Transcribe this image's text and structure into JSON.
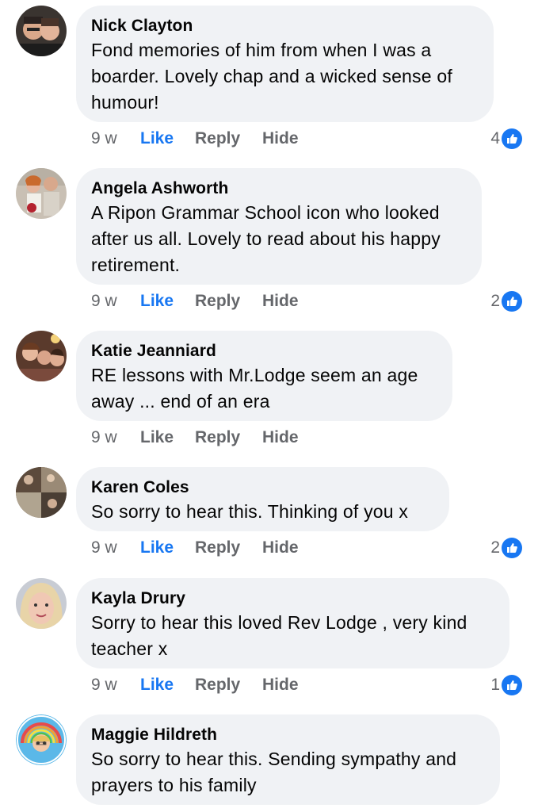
{
  "comments": [
    {
      "author": "Nick Clayton",
      "text": "Fond memories of him from when I was a boarder. Lovely chap and a wicked sense of humour!",
      "time": "9 w",
      "like_label": "Like",
      "reply_label": "Reply",
      "hide_label": "Hide",
      "liked": true,
      "reaction_count": "4"
    },
    {
      "author": "Angela Ashworth",
      "text": "A Ripon Grammar School icon who looked after us all. Lovely to read about his happy retirement.",
      "time": "9 w",
      "like_label": "Like",
      "reply_label": "Reply",
      "hide_label": "Hide",
      "liked": true,
      "reaction_count": "2"
    },
    {
      "author": "Katie Jeanniard",
      "text": "RE lessons with Mr.Lodge seem an age away ... end of an era",
      "time": "9 w",
      "like_label": "Like",
      "reply_label": "Reply",
      "hide_label": "Hide",
      "liked": false,
      "reaction_count": ""
    },
    {
      "author": "Karen Coles",
      "text": "So sorry to hear this. Thinking of you x",
      "time": "9 w",
      "like_label": "Like",
      "reply_label": "Reply",
      "hide_label": "Hide",
      "liked": true,
      "reaction_count": "2"
    },
    {
      "author": "Kayla Drury",
      "text": "Sorry to hear this loved Rev Lodge , very kind teacher x",
      "time": "9 w",
      "like_label": "Like",
      "reply_label": "Reply",
      "hide_label": "Hide",
      "liked": true,
      "reaction_count": "1"
    },
    {
      "author": "Maggie Hildreth",
      "text": "So sorry to hear this. Sending sympathy and prayers to his family",
      "time": "",
      "like_label": "",
      "reply_label": "",
      "hide_label": "",
      "liked": false,
      "reaction_count": ""
    }
  ],
  "colors": {
    "bubble": "#f0f2f5",
    "like_active": "#1877f2",
    "meta": "#65676b"
  },
  "icons": {
    "reaction": "thumbs-up-icon"
  }
}
